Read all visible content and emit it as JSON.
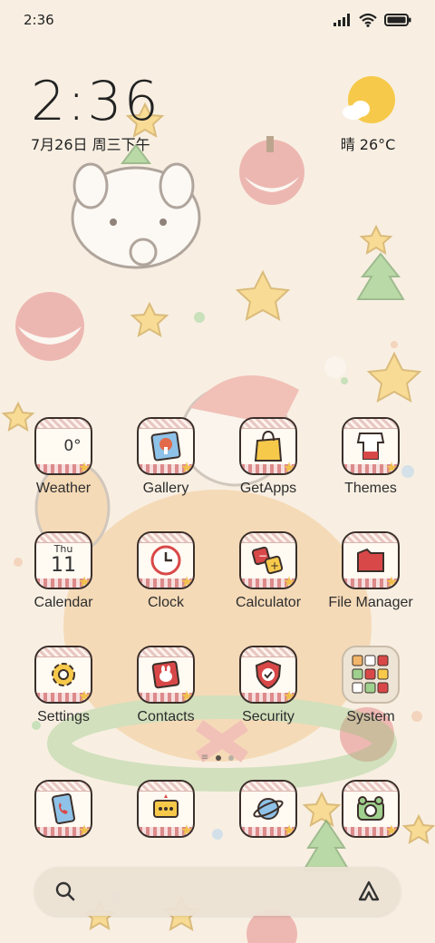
{
  "status_bar": {
    "time": "2:36",
    "icons": [
      "signal-icon",
      "wifi-icon",
      "battery-icon"
    ]
  },
  "clock_widget": {
    "time": "2:36",
    "date": "7月26日 周三下午"
  },
  "weather_widget": {
    "condition_icon": "sun-cloud-icon",
    "text": "晴 26°C"
  },
  "apps": [
    {
      "label": "Weather",
      "icon": "weather-icon",
      "badge": "0°"
    },
    {
      "label": "Gallery",
      "icon": "gallery-icon"
    },
    {
      "label": "GetApps",
      "icon": "shopping-bag-icon"
    },
    {
      "label": "Themes",
      "icon": "themes-icon"
    },
    {
      "label": "Calendar",
      "icon": "calendar-icon",
      "day": "Thu",
      "date": "11"
    },
    {
      "label": "Clock",
      "icon": "clock-icon"
    },
    {
      "label": "Calculator",
      "icon": "calculator-icon"
    },
    {
      "label": "File Manager",
      "icon": "folder-icon"
    },
    {
      "label": "Settings",
      "icon": "gear-icon"
    },
    {
      "label": "Contacts",
      "icon": "contacts-icon"
    },
    {
      "label": "Security",
      "icon": "shield-icon"
    },
    {
      "label": "System",
      "icon": "folder-grid-icon"
    }
  ],
  "dock": [
    {
      "icon": "phone-icon"
    },
    {
      "icon": "messages-icon"
    },
    {
      "icon": "browser-icon"
    },
    {
      "icon": "camera-icon"
    }
  ],
  "page_indicator": {
    "pages": 2,
    "active": 1
  },
  "search_bar": {
    "left_icon": "search-icon",
    "right_icon": "assistant-icon"
  },
  "colors": {
    "background": "#f8efe2",
    "tile_border": "#3b2f2a",
    "accent_red": "#d94848",
    "accent_yellow": "#f1c14b"
  }
}
